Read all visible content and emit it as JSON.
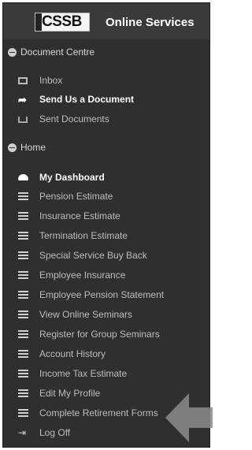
{
  "header": {
    "logo_text": "CSSB",
    "title": "Online Services"
  },
  "sections": {
    "document_centre": {
      "label": "Document Centre",
      "items": [
        {
          "label": "Inbox",
          "icon": "inbox-icon"
        },
        {
          "label": "Send Us a Document",
          "icon": "send-icon",
          "active": true
        },
        {
          "label": "Sent Documents",
          "icon": "sent-documents-icon"
        }
      ]
    },
    "home": {
      "label": "Home",
      "items": [
        {
          "label": "My Dashboard",
          "icon": "dashboard-icon",
          "active": true
        },
        {
          "label": "Pension Estimate",
          "icon": "list-icon"
        },
        {
          "label": "Insurance Estimate",
          "icon": "list-icon"
        },
        {
          "label": "Termination Estimate",
          "icon": "list-icon"
        },
        {
          "label": "Special Service Buy Back",
          "icon": "list-icon"
        },
        {
          "label": "Employee Insurance",
          "icon": "list-icon"
        },
        {
          "label": "Employee Pension Statement",
          "icon": "list-icon"
        },
        {
          "label": "View Online Seminars",
          "icon": "list-icon"
        },
        {
          "label": "Register for Group Seminars",
          "icon": "list-icon"
        },
        {
          "label": "Account History",
          "icon": "list-icon"
        },
        {
          "label": "Income Tax Estimate",
          "icon": "list-icon"
        },
        {
          "label": "Edit My Profile",
          "icon": "list-icon"
        },
        {
          "label": "Complete Retirement Forms",
          "icon": "list-icon"
        },
        {
          "label": "Log Off",
          "icon": "log-off-icon"
        }
      ]
    }
  },
  "colors": {
    "panel": "#2f2f2f",
    "active_text": "#ffffff",
    "muted_text": "#bdbdbd",
    "arrow": "#8c8c8c"
  }
}
